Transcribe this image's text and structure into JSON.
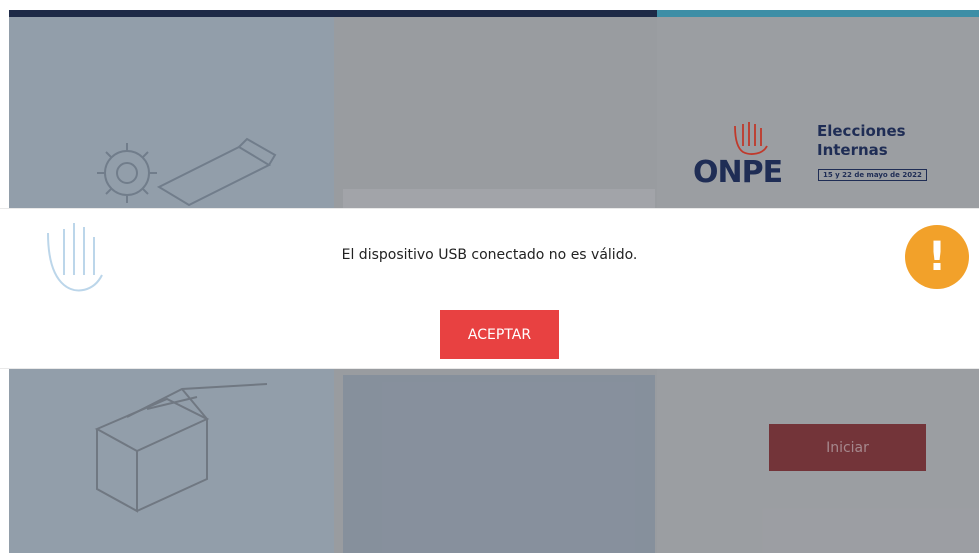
{
  "brand": {
    "logo_word": "ONPE",
    "title_line1": "Elecciones",
    "title_line2": "Internas",
    "dates": "15 y 22 de mayo de 2022"
  },
  "background": {
    "start_button": "Iniciar"
  },
  "dialog": {
    "message": "El dispositivo USB conectado no es válido.",
    "accept_label": "ACEPTAR",
    "icon": "warning-icon"
  },
  "colors": {
    "accent_red": "#e84141",
    "navy": "#1f2d55",
    "warning": "#f2a12a",
    "teal": "#3d8ea6"
  }
}
